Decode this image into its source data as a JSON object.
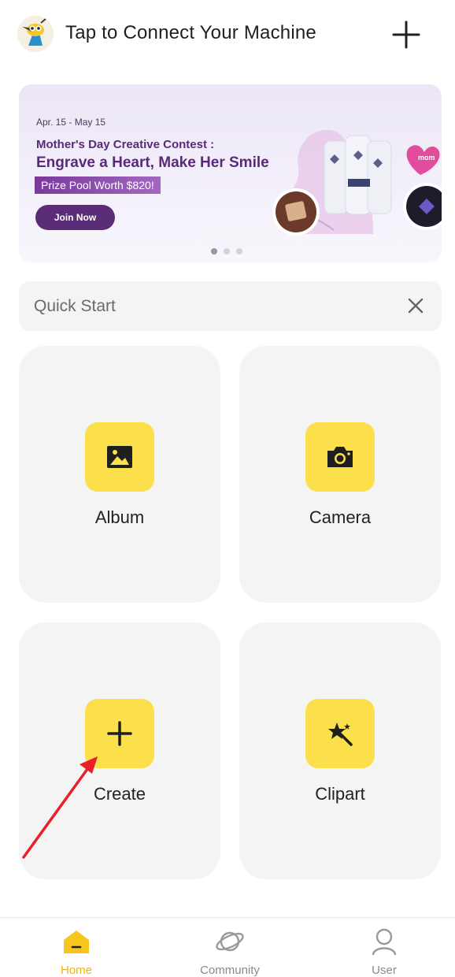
{
  "header": {
    "title": "Tap to Connect Your Machine"
  },
  "banner": {
    "date_range": "Apr. 15 - May 15",
    "headline": "Mother's Day Creative Contest :",
    "subheadline": "Engrave a Heart, Make Her Smile",
    "prize": "Prize Pool Worth $820!",
    "cta": "Join Now",
    "art_tag": "mom",
    "slide_count": 3,
    "active_slide": 1
  },
  "quick_start": {
    "label": "Quick Start"
  },
  "tiles": [
    {
      "label": "Album",
      "icon": "image-icon"
    },
    {
      "label": "Camera",
      "icon": "camera-icon"
    },
    {
      "label": "Create",
      "icon": "plus-icon"
    },
    {
      "label": "Clipart",
      "icon": "star-wand-icon"
    }
  ],
  "bottom_nav": {
    "items": [
      {
        "label": "Home",
        "icon": "home-icon",
        "active": true
      },
      {
        "label": "Community",
        "icon": "planet-icon",
        "active": false
      },
      {
        "label": "User",
        "icon": "user-icon",
        "active": false
      }
    ]
  },
  "colors": {
    "accent_yellow": "#fbe04b",
    "active_nav": "#f2b50f",
    "banner_purple": "#5a2a7a",
    "annotation_arrow": "#e8202a"
  }
}
